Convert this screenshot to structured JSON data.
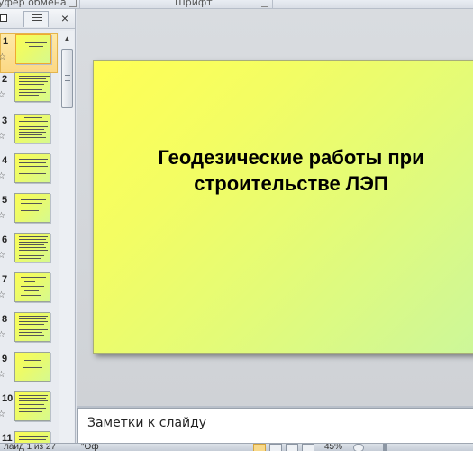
{
  "ribbon": {
    "groups": [
      {
        "label": "уфер обмена"
      },
      {
        "label": "Шрифт"
      }
    ]
  },
  "panel": {
    "tab_slides_icon": "slides-tab-icon",
    "tab_outline_icon": "outline-tab-icon",
    "close_glyph": "×",
    "slides": [
      {
        "number": "1",
        "selected": true
      },
      {
        "number": "2",
        "selected": false
      },
      {
        "number": "3",
        "selected": false
      },
      {
        "number": "4",
        "selected": false
      },
      {
        "number": "5",
        "selected": false
      },
      {
        "number": "6",
        "selected": false
      },
      {
        "number": "7",
        "selected": false
      },
      {
        "number": "8",
        "selected": false
      },
      {
        "number": "9",
        "selected": false
      },
      {
        "number": "10",
        "selected": false
      },
      {
        "number": "11",
        "selected": false
      }
    ],
    "star_glyph": "☆",
    "scroll_up_glyph": "▲"
  },
  "slide": {
    "title_line1": "Геодезические работы при",
    "title_line2": "строительстве ЛЭП"
  },
  "notes": {
    "placeholder": "Заметки к слайду"
  },
  "status": {
    "slide_indicator": "лайд 1 из 27",
    "theme": "\"Оф",
    "zoom": "45%"
  },
  "colors": {
    "slide_gradient_start": "#ffff55",
    "slide_gradient_end": "#ccf79a",
    "selected_thumb": "#fcd884",
    "panel_bg": "#e8ebf0",
    "edit_bg": "#d5d8dc"
  }
}
